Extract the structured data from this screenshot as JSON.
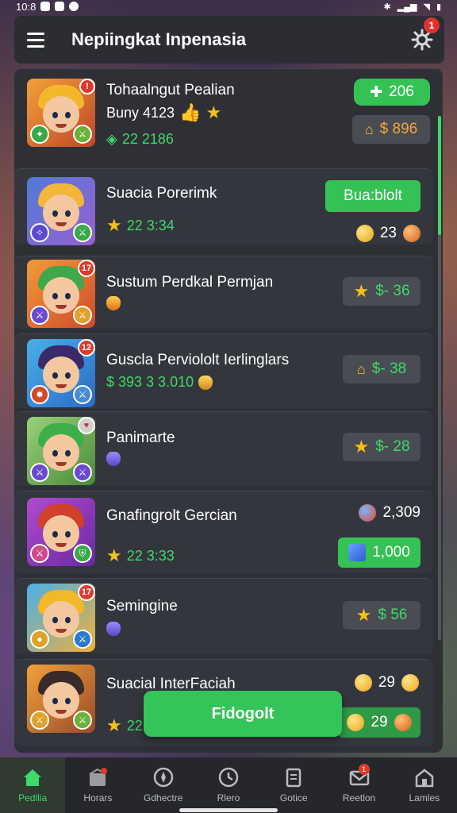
{
  "status": {
    "time": "10:8"
  },
  "header": {
    "title": "Nepiingkat Inpenasia",
    "settings_badge": "1"
  },
  "list": [
    {
      "name": "Tohaalngut Pealian",
      "line2": "Buny 4123",
      "line3": "22  2186",
      "badge": "",
      "action": "206",
      "value": "$  896",
      "colors": {
        "bg1": "#f0a13a",
        "bg2": "#c2442a",
        "hair": "#f3b72a"
      }
    },
    {
      "name": "Suacia Porerimk",
      "score": "22  3:34",
      "action": "Bua:blolt",
      "value": "23",
      "colors": {
        "bg1": "#4f7bd6",
        "bg2": "#9a5fd0",
        "hair": "#f2b63a"
      }
    },
    {
      "name": "Sustum Perdkal Permjan",
      "badge": "17",
      "value": "$- 36",
      "colors": {
        "bg1": "#f19a3a",
        "bg2": "#d04a2a",
        "hair": "#3fa84a"
      }
    },
    {
      "name": "Guscla Perviololt Ierlinglars",
      "badge": "12",
      "score": "$  393  3  3.010",
      "value": "$- 38",
      "colors": {
        "bg1": "#4ab0e8",
        "bg2": "#2a6ac8",
        "hair": "#3a2a6a"
      }
    },
    {
      "name": "Panimarte",
      "value": "$- 28",
      "colors": {
        "bg1": "#9ad07a",
        "bg2": "#4a8a3a",
        "hair": "#3fae4a"
      }
    },
    {
      "name": "Gnafingrolt Gercian",
      "score": "22  3:33",
      "top_value": "2,309",
      "action": "1,000",
      "colors": {
        "bg1": "#b04ad0",
        "bg2": "#6a2aa0",
        "hair": "#d0402a"
      }
    },
    {
      "name": "Semingine",
      "badge": "17",
      "value": "$  56",
      "colors": {
        "bg1": "#4ab0e8",
        "bg2": "#f0b03a",
        "hair": "#f3b72a"
      }
    },
    {
      "name": "Suacial InterFaciah",
      "score": "22",
      "top_value": "29",
      "action": "29",
      "colors": {
        "bg1": "#f0a13a",
        "bg2": "#9a4a2a",
        "hair": "#3a2a2a"
      }
    }
  ],
  "fab": {
    "label": "Fidogolt"
  },
  "nav": [
    {
      "label": "Pedllia",
      "icon": "home-icon",
      "badge": ""
    },
    {
      "label": "Horars",
      "icon": "shop-icon",
      "badge": ""
    },
    {
      "label": "Gdhectre",
      "icon": "compass-icon",
      "badge": ""
    },
    {
      "label": "Rlero",
      "icon": "clock-icon",
      "badge": ""
    },
    {
      "label": "Gotice",
      "icon": "document-icon",
      "badge": ""
    },
    {
      "label": "Reetlon",
      "icon": "mail-icon",
      "badge": "1"
    },
    {
      "label": "Lamles",
      "icon": "store-icon",
      "badge": ""
    }
  ]
}
